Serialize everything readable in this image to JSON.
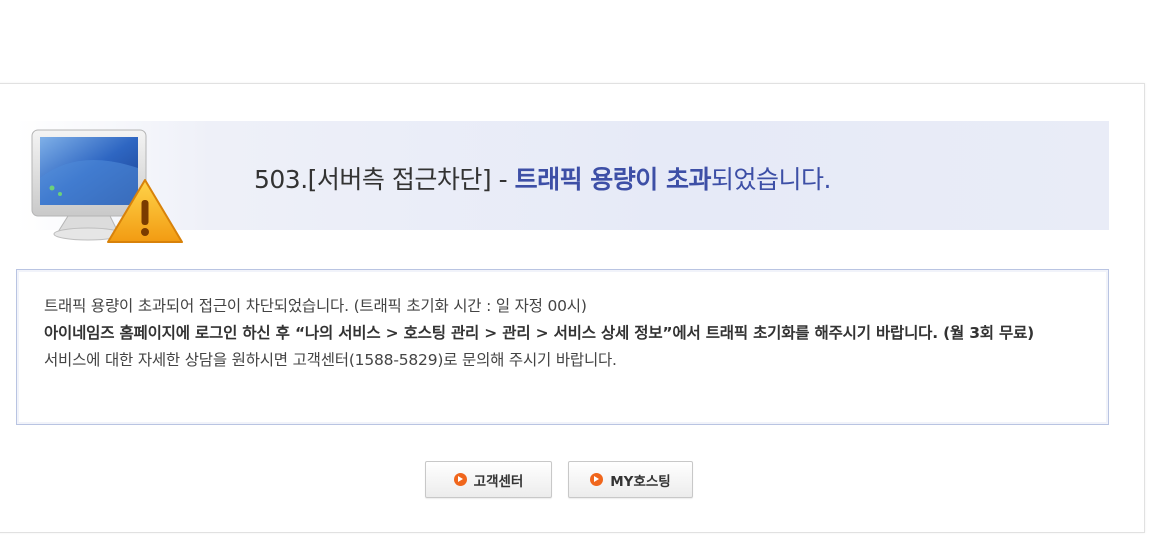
{
  "header": {
    "code": "503.",
    "bracket_text": "[서버측 접근차단]",
    "dash": " - ",
    "emphasis": "트래픽 용량이 초과",
    "tail": "되었습니다."
  },
  "message": {
    "line1": "트래픽 용량이 초과되어 접근이 차단되었습니다. (트래픽 초기화 시간 : 일 자정 00시)",
    "line2": "아이네임즈 홈페이지에 로그인 하신 후 “나의 서비스 > 호스팅 관리 > 관리 > 서비스 상세 정보”에서 트래픽 초기화를 해주시기 바랍니다. (월 3회 무료)",
    "line3": "서비스에 대한 자세한 상담을 원하시면 고객센터(1588-5829)로 문의해 주시기 바랍니다."
  },
  "buttons": {
    "support_label": "고객센터",
    "myhosting_label": "MY호스팅"
  },
  "icons": {
    "illustration": "monitor-warning-icon",
    "button_bullet": "arrow-circle-icon"
  },
  "colors": {
    "accent": "#3d4fa6",
    "bullet": "#f0661c"
  }
}
